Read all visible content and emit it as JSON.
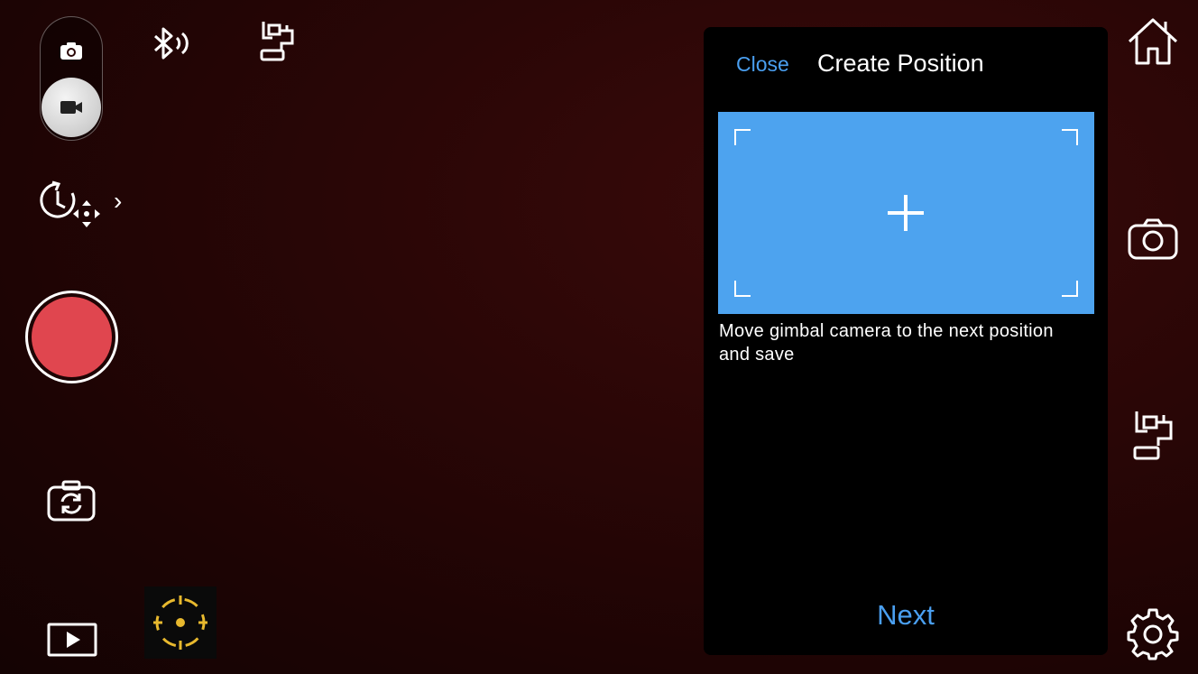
{
  "left_toolbar": {
    "mode_switch": {
      "photo_icon": "camera-small-icon",
      "video_icon": "video-camera-icon",
      "selected": "video"
    },
    "timelapse_icon": "timelapse-motion-icon",
    "expand_chevron": "›",
    "record_color": "#e0464f",
    "switch_camera_icon": "switch-camera-icon",
    "playback_icon": "playback-icon"
  },
  "top_status": {
    "bluetooth_icon": "bluetooth-connected-icon",
    "gimbal_icon": "gimbal-icon"
  },
  "focus_icon": "focus-target-icon",
  "panel": {
    "close_label": "Close",
    "title": "Create Position",
    "instruction": "Move gimbal camera to the next position and save",
    "next_label": "Next",
    "capture_color": "#4da3ef",
    "accent_color": "#4a9ff0"
  },
  "right_toolbar": {
    "home_icon": "home-icon",
    "camera_icon": "camera-icon",
    "gimbal_icon": "gimbal-icon",
    "settings_icon": "gear-icon"
  }
}
